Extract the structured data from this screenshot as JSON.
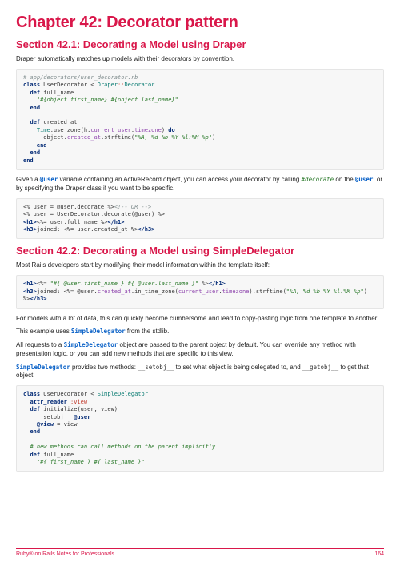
{
  "chapter": {
    "title": "Chapter 42: Decorator pattern"
  },
  "sections": {
    "s1": {
      "title": "Section 42.1: Decorating a Model using Draper"
    },
    "s2": {
      "title": "Section 42.2: Decorating a Model using SimpleDelegator"
    }
  },
  "paragraphs": {
    "p1": "Draper automatically matches up models with their decorators by convention.",
    "p2a": "Given a ",
    "p2b": " variable containing an ActiveRecord object, you can access your decorator by calling ",
    "p2c": " on the ",
    "p2d": ", or by specifying the Draper class if you want to be specific.",
    "p3": "Most Rails developers start by modifying their model information within the template itself:",
    "p4": "For models with a lot of data, this can quickly become cumbersome and lead to copy-pasting logic from one template to another.",
    "p5a": "This example uses ",
    "p5b": " from the stdlib.",
    "p6a": "All requests to a ",
    "p6b": " object are passed to the parent object by default. You can override any method with presentation logic, or you can add new methods that are specific to this view.",
    "p7a": " provides two methods: ",
    "p7b": " to set what object is being delegated to, and ",
    "p7c": " to get that object."
  },
  "inline": {
    "at_user": "@user",
    "decorate": "#decorate",
    "simple_delegator": "SimpleDelegator",
    "setobj": "__setobj__",
    "getobj": "__getobj__"
  },
  "code": {
    "c1": {
      "l1": "# app/decorators/user_decorator.rb",
      "l2a": "class",
      "l2b": " UserDecorator < ",
      "l2c": "Draper",
      "l2d": "::",
      "l2e": "Decorator",
      "l3a": "  def",
      "l3b": " full_name",
      "l4": "    \"#{object.first_name} #{object.last_name}\"",
      "l5": "  end",
      "l6": "",
      "l7a": "  def",
      "l7b": " created_at",
      "l8a": "    Time",
      "l8b": ".use_zone(h.",
      "l8c": "current_user",
      "l8d": ".",
      "l8e": "timezone",
      "l8f": ") ",
      "l8g": "do",
      "l9a": "      object.",
      "l9b": "created_at",
      "l9c": ".strftime(",
      "l9d": "\"%A, %d %b %Y %l:%M %p\"",
      "l9e": ")",
      "l10": "    end",
      "l11": "  end",
      "l12": "end"
    },
    "c2": {
      "l1a": "<% user = @user.decorate %>",
      "l1b": "<!-- OR -->",
      "l2": "<% user = UserDecorator.decorate(@user) %>",
      "l3a": "<h1>",
      "l3b": "<%= user.full_name %>",
      "l3c": "</h1>",
      "l4a": "<h3>",
      "l4b": "joined: ",
      "l4c": "<%= user.created_at %>",
      "l4d": "</h3>"
    },
    "c3": {
      "l1a": "<h1>",
      "l1b": "<%= ",
      "l1c": "\"#{ @user.first_name } #{ @user.last_name }\"",
      "l1d": " %>",
      "l1e": "</h1>",
      "l2a": "<h3>",
      "l2b": "joined: ",
      "l2c": "<%= @user.",
      "l2d": "created_at",
      "l2e": ".in_time_zone(",
      "l2f": "current_user",
      "l2g": ".",
      "l2h": "timezone",
      "l2i": ").strftime(",
      "l2j": "\"%A, %d %b %Y %l:%M %p\"",
      "l2k": ") %>",
      "l2l": "</h3>"
    },
    "c4": {
      "l1a": "class",
      "l1b": " UserDecorator < ",
      "l1c": "SimpleDelegator",
      "l2a": "  attr_reader",
      "l2b": " :view",
      "l3a": "  def",
      "l3b": " initialize(user, view)",
      "l4a": "    __setobj__ ",
      "l4b": "@user",
      "l5a": "    @view",
      "l5b": " = view",
      "l6": "  end",
      "l7": "",
      "l8": "  # new methods can call methods on the parent implicitly",
      "l9a": "  def",
      "l9b": " full_name",
      "l10": "    \"#{ first_name } #{ last_name }\""
    }
  },
  "footer": {
    "left": "Ruby® on Rails Notes for Professionals",
    "right": "164"
  }
}
